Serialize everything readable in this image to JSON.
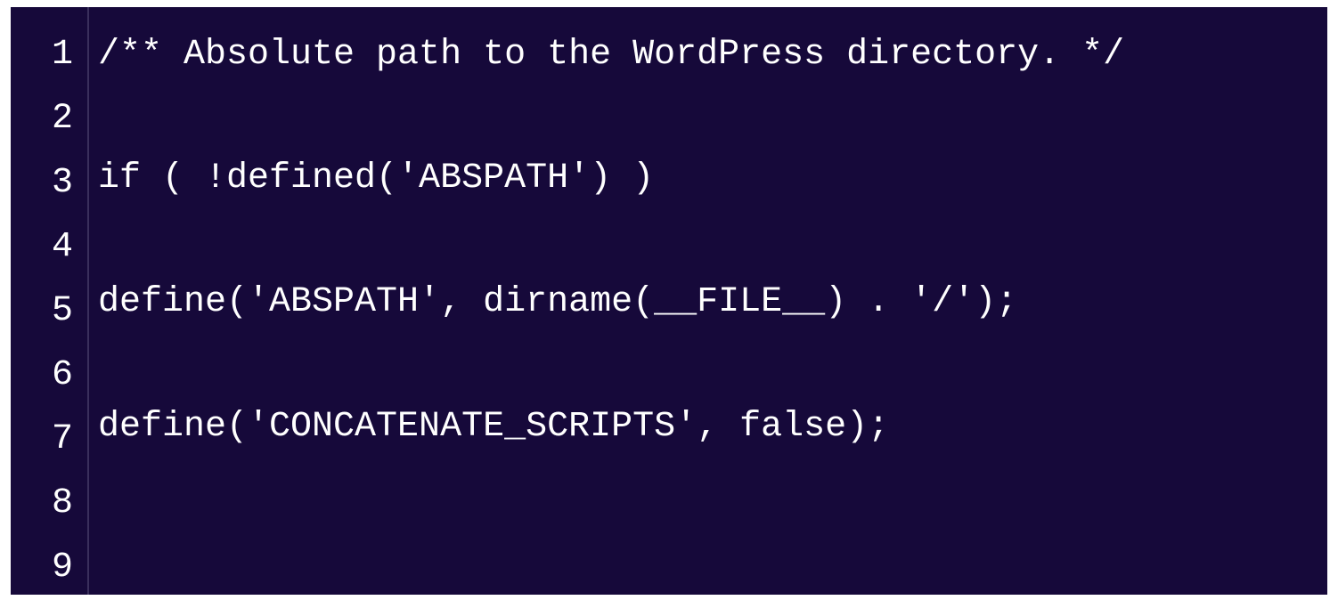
{
  "editor": {
    "lines": [
      {
        "num": "1",
        "code": "/** Absolute path to the WordPress directory. */"
      },
      {
        "num": "2",
        "code": ""
      },
      {
        "num": "3",
        "code": "if ( !defined('ABSPATH') )"
      },
      {
        "num": "4",
        "code": ""
      },
      {
        "num": "5",
        "code": "define('ABSPATH', dirname(__FILE__) . '/');"
      },
      {
        "num": "6",
        "code": ""
      },
      {
        "num": "7",
        "code": "define('CONCATENATE_SCRIPTS', false);"
      },
      {
        "num": "8",
        "code": ""
      },
      {
        "num": "9",
        "code": ""
      }
    ]
  }
}
